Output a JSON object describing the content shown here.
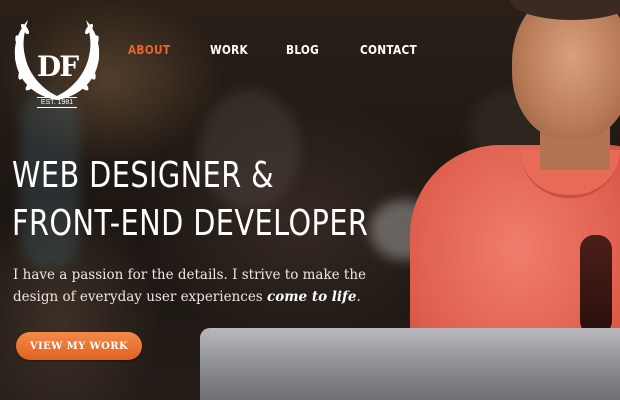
{
  "logo": {
    "monogram": "DF",
    "established": "EST. 1981"
  },
  "nav": {
    "items": [
      {
        "label": "ABOUT",
        "active": true
      },
      {
        "label": "WORK",
        "active": false
      },
      {
        "label": "BLOG",
        "active": false
      },
      {
        "label": "CONTACT",
        "active": false
      }
    ]
  },
  "hero": {
    "headline_line1": "WEB DESIGNER &",
    "headline_line2": "FRONT-END DEVELOPER",
    "tagline_part1": "I have a passion for the details.  I strive to make the design of everyday user experiences ",
    "tagline_emphasis": "come to life",
    "tagline_end": ".",
    "cta_label": "VIEW MY WORK"
  },
  "colors": {
    "accent": "#e8662e",
    "button": "#ea6f2f",
    "text": "#ffffff"
  }
}
